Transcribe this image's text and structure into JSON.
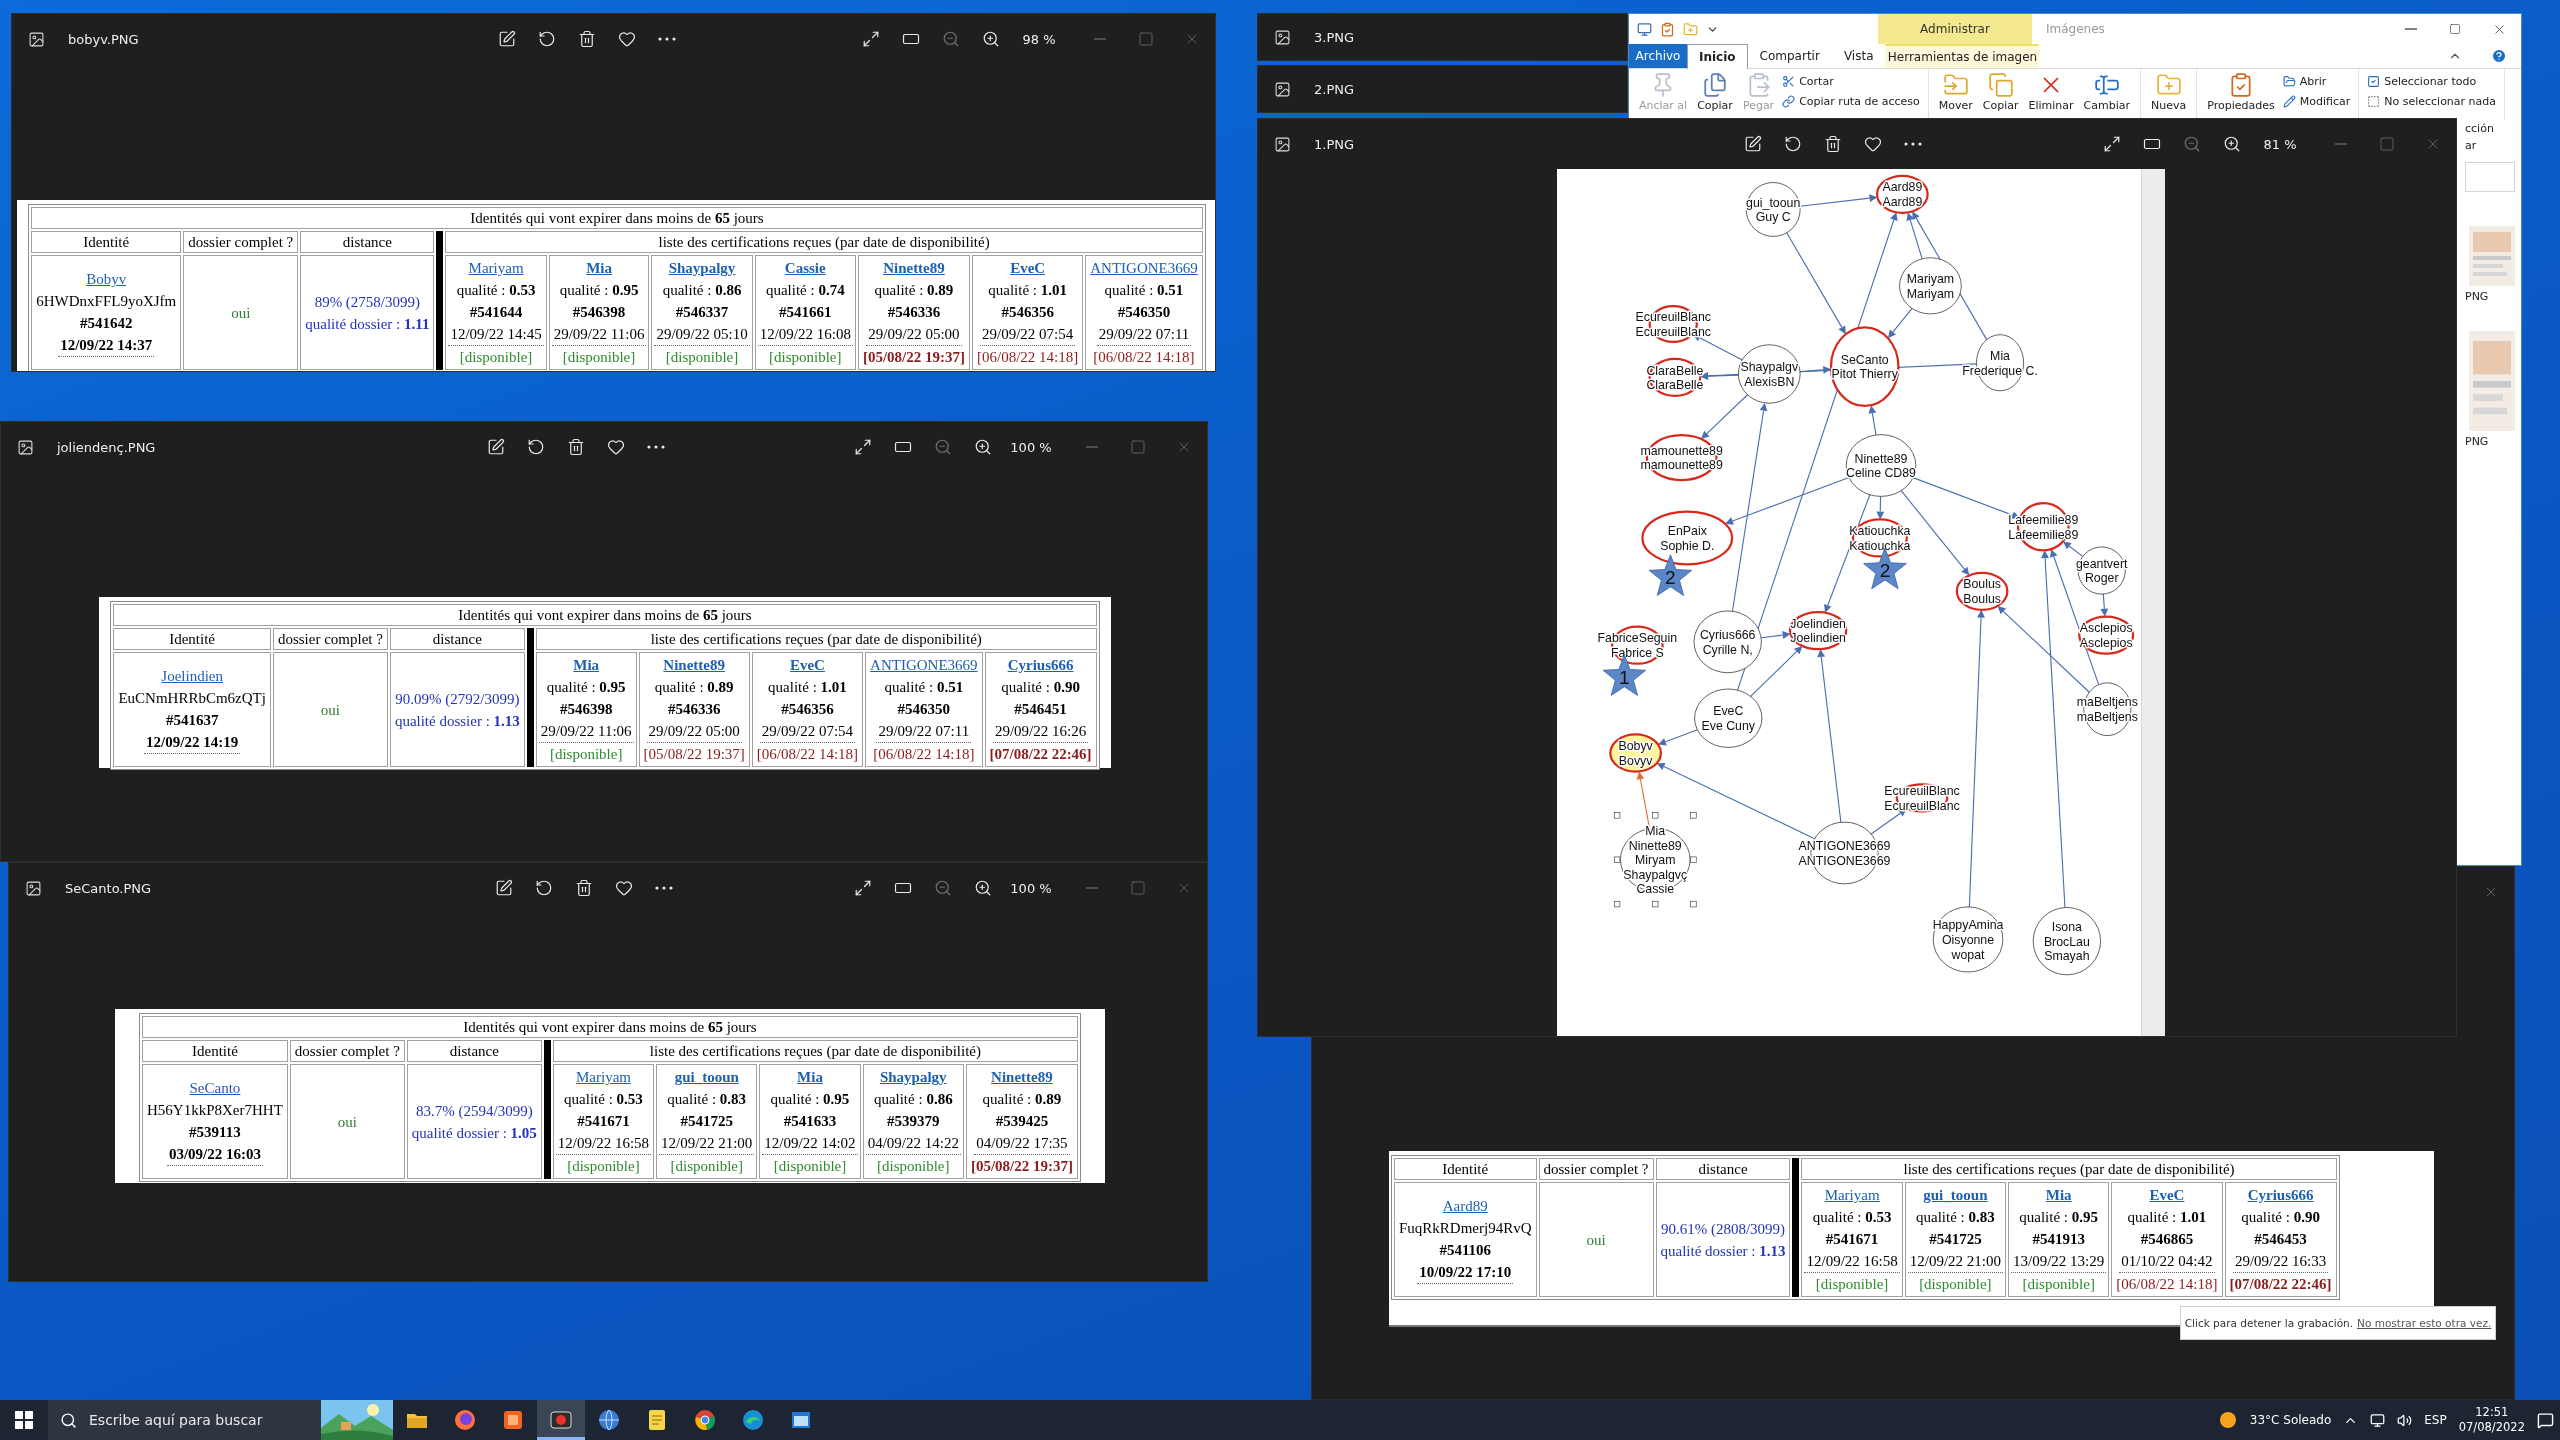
{
  "viewers": [
    {
      "title": "bobyv.PNG",
      "zoom": "98 %",
      "table": {
        "caption": "Identités qui vont expirer dans moins de **65** jours",
        "headers": [
          "Identité",
          "dossier complet ?",
          "distance",
          "liste des certifications reçues (par date de disponibilité)"
        ],
        "identity": {
          "name": "Bobyv",
          "key": "6HWDnxFFL9yoXJfm",
          "number": "#541642",
          "date": "12/09/22 14:37"
        },
        "complete": "oui",
        "distance": {
          "percent": "89% (2758/3099)",
          "quality": "qualité dossier : **1.11**"
        },
        "certs": [
          {
            "name": "Mariyam",
            "bold": false,
            "quality": "qualité : **0.53**",
            "number": "#541644",
            "date": "12/09/22 14:45",
            "status": "[disponible]",
            "kind": "available",
            "strong": false
          },
          {
            "name": "Mia",
            "bold": true,
            "quality": "qualité : **0.95**",
            "number": "#546398",
            "date": "29/09/22 11:06",
            "status": "[disponible]",
            "kind": "available",
            "strong": false
          },
          {
            "name": "Shaypalgy",
            "bold": true,
            "quality": "qualité : **0.86**",
            "number": "#546337",
            "date": "29/09/22 05:10",
            "status": "[disponible]",
            "kind": "available",
            "strong": false
          },
          {
            "name": "Cassie",
            "bold": true,
            "quality": "qualité : **0.74**",
            "number": "#541661",
            "date": "12/09/22 16:08",
            "status": "[disponible]",
            "kind": "available",
            "strong": false
          },
          {
            "name": "Ninette89",
            "bold": true,
            "quality": "qualité : **0.89**",
            "number": "#546336",
            "date": "29/09/22 05:00",
            "status": "[05/08/22 19:37]",
            "kind": "expired",
            "strong": true
          },
          {
            "name": "EveC",
            "bold": true,
            "quality": "qualité : **1.01**",
            "number": "#546356",
            "date": "29/09/22 07:54",
            "status": "[06/08/22 14:18]",
            "kind": "expired",
            "strong": false
          },
          {
            "name": "ANTIGONE3669",
            "bold": false,
            "quality": "qualité : **0.51**",
            "number": "#546350",
            "date": "29/09/22 07:11",
            "status": "[06/08/22 14:18]",
            "kind": "expired",
            "strong": false
          }
        ]
      }
    },
    {
      "title": "joliendenç.PNG",
      "zoom": "100 %",
      "table": {
        "caption": "Identités qui vont expirer dans moins de **65** jours",
        "headers": [
          "Identité",
          "dossier complet ?",
          "distance",
          "liste des certifications reçues (par date de disponibilité)"
        ],
        "identity": {
          "name": "Joelindien",
          "key": "EuCNmHRRbCm6zQTj",
          "number": "#541637",
          "date": "12/09/22 14:19"
        },
        "complete": "oui",
        "distance": {
          "percent": "90.09% (2792/3099)",
          "quality": "qualité dossier : **1.13**"
        },
        "certs": [
          {
            "name": "Mia",
            "bold": true,
            "quality": "qualité : **0.95**",
            "number": "#546398",
            "date": "29/09/22 11:06",
            "status": "[disponible]",
            "kind": "available",
            "strong": false
          },
          {
            "name": "Ninette89",
            "bold": true,
            "quality": "qualité : **0.89**",
            "number": "#546336",
            "date": "29/09/22 05:00",
            "status": "[05/08/22 19:37]",
            "kind": "expired",
            "strong": false
          },
          {
            "name": "EveC",
            "bold": true,
            "quality": "qualité : **1.01**",
            "number": "#546356",
            "date": "29/09/22 07:54",
            "status": "[06/08/22 14:18]",
            "kind": "expired",
            "strong": false
          },
          {
            "name": "ANTIGONE3669",
            "bold": false,
            "quality": "qualité : **0.51**",
            "number": "#546350",
            "date": "29/09/22 07:11",
            "status": "[06/08/22 14:18]",
            "kind": "expired",
            "strong": false
          },
          {
            "name": "Cyrius666",
            "bold": true,
            "quality": "qualité : **0.90**",
            "number": "#546451",
            "date": "29/09/22 16:26",
            "status": "[07/08/22 22:46]",
            "kind": "expired",
            "strong": true
          }
        ]
      }
    },
    {
      "title": "SeCanto.PNG",
      "zoom": "100 %",
      "table": {
        "caption": "Identités qui vont expirer dans moins de **65** jours",
        "headers": [
          "Identité",
          "dossier complet ?",
          "distance",
          "liste des certifications reçues (par date de disponibilité)"
        ],
        "identity": {
          "name": "SeCanto",
          "key": "H56Y1kkP8Xer7HHT",
          "number": "#539113",
          "date": "03/09/22 16:03"
        },
        "complete": "oui",
        "distance": {
          "percent": "83.7% (2594/3099)",
          "quality": "qualité dossier : **1.05**"
        },
        "certs": [
          {
            "name": "Mariyam",
            "bold": false,
            "quality": "qualité : **0.53**",
            "number": "#541671",
            "date": "12/09/22 16:58",
            "status": "[disponible]",
            "kind": "available",
            "strong": false
          },
          {
            "name": "gui_tooun",
            "bold": true,
            "quality": "qualité : **0.83**",
            "number": "#541725",
            "date": "12/09/22 21:00",
            "status": "[disponible]",
            "kind": "available",
            "strong": false
          },
          {
            "name": "Mia",
            "bold": true,
            "quality": "qualité : **0.95**",
            "number": "#541633",
            "date": "12/09/22 14:02",
            "status": "[disponible]",
            "kind": "available",
            "strong": false
          },
          {
            "name": "Shaypalgy",
            "bold": true,
            "quality": "qualité : **0.86**",
            "number": "#539379",
            "date": "04/09/22 14:22",
            "status": "[disponible]",
            "kind": "available",
            "strong": false
          },
          {
            "name": "Ninette89",
            "bold": true,
            "quality": "qualité : **0.89**",
            "number": "#539425",
            "date": "04/09/22 17:35",
            "status": "[05/08/22 19:37]",
            "kind": "expired",
            "strong": true
          }
        ]
      }
    }
  ],
  "background_viewer": {
    "table": {
      "headers": [
        "Identité",
        "dossier complet ?",
        "distance",
        "liste des certifications reçues (par date de disponibilité)"
      ],
      "identity": {
        "name": "Aard89",
        "key": "FuqRkRDmerj94RvQ",
        "number": "#541106",
        "date": "10/09/22 17:10"
      },
      "complete": "oui",
      "distance": {
        "percent": "90.61% (2808/3099)",
        "quality": "qualité dossier : **1.13**"
      },
      "certs": [
        {
          "name": "Mariyam",
          "bold": false,
          "quality": "qualité : **0.53**",
          "number": "#541671",
          "date": "12/09/22 16:58",
          "status": "[disponible]",
          "kind": "available",
          "strong": false
        },
        {
          "name": "gui_tooun",
          "bold": true,
          "quality": "qualité : **0.83**",
          "number": "#541725",
          "date": "12/09/22 21:00",
          "status": "[disponible]",
          "kind": "available",
          "strong": false
        },
        {
          "name": "Mia",
          "bold": true,
          "quality": "qualité : **0.95**",
          "number": "#541913",
          "date": "13/09/22 13:29",
          "status": "[disponible]",
          "kind": "available",
          "strong": false
        },
        {
          "name": "EveC",
          "bold": true,
          "quality": "qualité : **1.01**",
          "number": "#546865",
          "date": "01/10/22 04:42",
          "status": "[06/08/22 14:18]",
          "kind": "expired",
          "strong": false
        },
        {
          "name": "Cyrius666",
          "bold": true,
          "quality": "qualité : **0.90**",
          "number": "#546453",
          "date": "29/09/22 16:33",
          "status": "[07/08/22 22:46]",
          "kind": "expired",
          "strong": true
        }
      ]
    }
  },
  "back_windows": [
    {
      "title": "3.PNG"
    },
    {
      "title": "2.PNG"
    }
  ],
  "explorer": {
    "context_header": "Administrar",
    "title": "Imágenes",
    "tabs": [
      {
        "label": "Archivo",
        "kind": "file",
        "selected": false
      },
      {
        "label": "Inicio",
        "kind": "tab",
        "selected": true
      },
      {
        "label": "Compartir",
        "kind": "tab",
        "selected": false
      },
      {
        "label": "Vista",
        "kind": "tab",
        "selected": false
      },
      {
        "label": "Herramientas de imagen",
        "kind": "context",
        "selected": false
      }
    ],
    "ribbon": [
      {
        "large": [
          {
            "label": "Anclar al",
            "disabled": true
          },
          {
            "label": "Copiar",
            "disabled": false
          },
          {
            "label": "Pegar",
            "disabled": true
          }
        ],
        "small": [
          {
            "label": "Cortar"
          },
          {
            "label": "Copiar ruta de acceso"
          }
        ]
      },
      {
        "large": [
          {
            "label": "Mover",
            "disabled": false
          },
          {
            "label": "Copiar",
            "disabled": false
          },
          {
            "label": "Eliminar",
            "disabled": false
          },
          {
            "label": "Cambiar",
            "disabled": false
          }
        ]
      },
      {
        "large": [
          {
            "label": "Nueva",
            "disabled": false
          }
        ]
      },
      {
        "large": [
          {
            "label": "Propiedades",
            "disabled": false
          }
        ],
        "small": [
          {
            "label": "Abrir"
          },
          {
            "label": "Modificar"
          }
        ]
      },
      {
        "small": [
          {
            "label": "Seleccionar todo"
          },
          {
            "label": "No seleccionar nada"
          }
        ]
      }
    ],
    "strip_texts": [
      "cción",
      "ar"
    ],
    "thumb_labels": [
      "PNG",
      "PNG"
    ]
  },
  "graph_viewer": {
    "title": "1.PNG",
    "zoom": "81 %",
    "graph": {
      "nodes": [
        {
          "lines": [
            "gui_tooun",
            "Guy C"
          ],
          "flagged": false,
          "highlighted": false,
          "selected": false
        },
        {
          "lines": [
            "Aard89",
            "Aard89"
          ],
          "flagged": true,
          "highlighted": false,
          "selected": false
        },
        {
          "lines": [
            "Mariyam",
            "Mariyam"
          ],
          "flagged": false,
          "highlighted": false,
          "selected": false
        },
        {
          "lines": [
            "EcureuilBlanc",
            "EcureuilBlanc"
          ],
          "flagged": true,
          "highlighted": false,
          "selected": false
        },
        {
          "lines": [
            "ClaraBelle",
            "ClaraBelle"
          ],
          "flagged": true,
          "highlighted": false,
          "selected": false
        },
        {
          "lines": [
            "Shaypalgv",
            "AlexisBN"
          ],
          "flagged": false,
          "highlighted": false,
          "selected": false
        },
        {
          "lines": [
            "SeCanto",
            "Pitot Thierry"
          ],
          "flagged": true,
          "highlighted": false,
          "selected": false
        },
        {
          "lines": [
            "Mia",
            "Frederique C."
          ],
          "flagged": false,
          "highlighted": false,
          "selected": false
        },
        {
          "lines": [
            "mamounette89",
            "mamounette89"
          ],
          "flagged": true,
          "highlighted": false,
          "selected": false
        },
        {
          "lines": [
            "Ninette89",
            "Celine CD89"
          ],
          "flagged": false,
          "highlighted": false,
          "selected": false
        },
        {
          "lines": [
            "EnPaix",
            "Sophie D."
          ],
          "flagged": true,
          "highlighted": false,
          "selected": false
        },
        {
          "lines": [
            "Katiouchka",
            "Katiouchka"
          ],
          "flagged": true,
          "highlighted": false,
          "selected": false
        },
        {
          "lines": [
            "Lafeemilie89",
            "Lafeemilie89"
          ],
          "flagged": true,
          "highlighted": false,
          "selected": false
        },
        {
          "lines": [
            "geantvert",
            "Roger"
          ],
          "flagged": false,
          "highlighted": false,
          "selected": false
        },
        {
          "lines": [
            "Boulus",
            "Boulus"
          ],
          "flagged": true,
          "highlighted": false,
          "selected": false
        },
        {
          "lines": [
            "Asclepios",
            "Asclepios"
          ],
          "flagged": true,
          "highlighted": false,
          "selected": false
        },
        {
          "lines": [
            "FabriceSeguin",
            "Fabrice S"
          ],
          "flagged": true,
          "highlighted": false,
          "selected": false
        },
        {
          "lines": [
            "Cyrius666",
            "Cyrille N,"
          ],
          "flagged": false,
          "highlighted": false,
          "selected": false
        },
        {
          "lines": [
            "Joelindien",
            "Joelindien"
          ],
          "flagged": true,
          "highlighted": false,
          "selected": false
        },
        {
          "lines": [
            "maBeltjens",
            "maBeltjens"
          ],
          "flagged": false,
          "highlighted": false,
          "selected": false
        },
        {
          "lines": [
            "EveC",
            "Eve Cuny"
          ],
          "flagged": false,
          "highlighted": false,
          "selected": false
        },
        {
          "lines": [
            "Bobyv",
            "Bovyv"
          ],
          "flagged": true,
          "highlighted": true,
          "selected": false
        },
        {
          "lines": [
            "EcureuilBlanc",
            "EcureuilBlanc"
          ],
          "flagged": true,
          "highlighted": false,
          "selected": false
        },
        {
          "lines": [
            "Mia",
            "Ninette89",
            "Miryam",
            "Shaypalgvç",
            "Cassie"
          ],
          "flagged": false,
          "highlighted": false,
          "selected": true
        },
        {
          "lines": [
            "ANTIGONE3669",
            "ANTIGONE3669"
          ],
          "flagged": false,
          "highlighted": false,
          "selected": false
        },
        {
          "lines": [
            "HappyAmina",
            "Oisyonne",
            "wopat"
          ],
          "flagged": false,
          "highlighted": false,
          "selected": false
        },
        {
          "lines": [
            "Isona",
            "BrocLau",
            "Smayah"
          ],
          "flagged": false,
          "highlighted": false,
          "selected": false
        }
      ],
      "stars": [
        {
          "label": "2"
        },
        {
          "label": "2"
        },
        {
          "label": "1"
        }
      ]
    }
  },
  "recorder_tip": {
    "text": "Click para detener la grabación.",
    "link": "No mostrar esto otra vez."
  },
  "taskbar": {
    "search_placeholder": "Escribe aquí para buscar",
    "apps": [
      {
        "active": false
      },
      {
        "active": false
      },
      {
        "active": false
      },
      {
        "active": true
      },
      {
        "active": false
      },
      {
        "active": false
      },
      {
        "active": false
      },
      {
        "active": false
      },
      {
        "active": false
      }
    ],
    "weather": "33°C Soleado",
    "language": "ESP",
    "time": "12:51",
    "date": "07/08/2022"
  }
}
